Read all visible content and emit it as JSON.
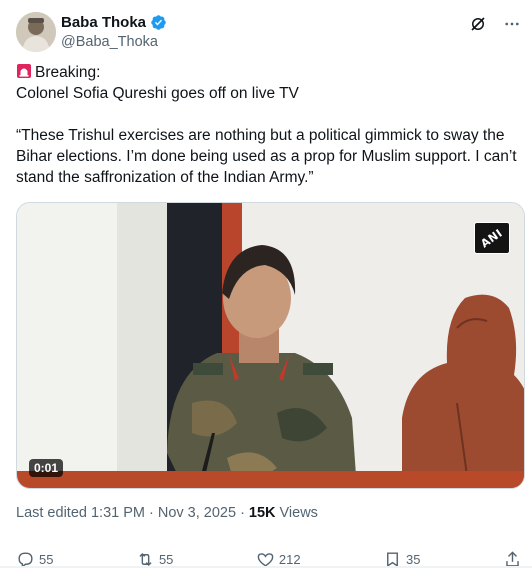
{
  "author": {
    "display_name": "Baba Thoka",
    "handle": "@Baba_Thoka",
    "verified": true
  },
  "tweet": {
    "line1": "Breaking:",
    "line2": "Colonel Sofia Qureshi goes off on live TV",
    "quote": "“These Trishul exercises are nothing but a political gimmick to sway the Bihar elections. I’m done being used as a prop for Muslim support. I can’t stand the saffronization of the Indian Army.”"
  },
  "media": {
    "watermark": "ANI",
    "duration": "0:01"
  },
  "meta": {
    "edited_label": "Last edited 1:31 PM · Nov 3, 2025 ·",
    "views_count": "15K",
    "views_label": "Views"
  },
  "actions": {
    "replies": "55",
    "reposts": "55",
    "likes": "212",
    "bookmarks": "35"
  },
  "colors": {
    "text": "#0f1419",
    "muted": "#536471",
    "verified": "#1d9bf0",
    "border": "#cfd9de"
  },
  "icons": [
    "verified-badge-icon",
    "grok-icon",
    "more-icon",
    "siren-icon",
    "reply-icon",
    "repost-icon",
    "like-icon",
    "bookmark-icon",
    "share-icon"
  ]
}
